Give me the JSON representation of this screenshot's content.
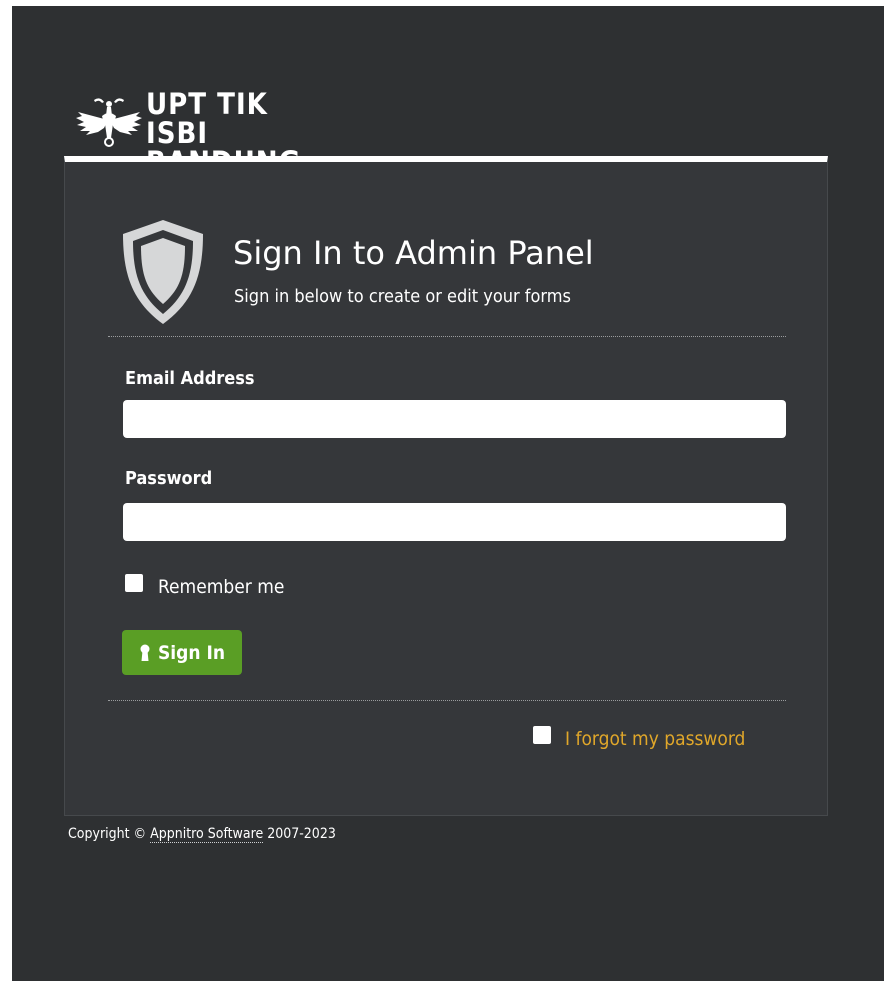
{
  "logo": {
    "line1": "UPT TIK",
    "line2": "ISBI BANDUNG",
    "icon": "isbi-emblem-icon"
  },
  "header": {
    "title": "Sign In to Admin Panel",
    "subtitle": "Sign in below to create or edit your forms",
    "icon": "shield-icon"
  },
  "form": {
    "email_label": "Email Address",
    "email_value": "",
    "password_label": "Password",
    "password_value": "",
    "remember_label": "Remember me",
    "signin_label": "Sign In",
    "signin_icon": "keyhole-icon",
    "forgot_label": "I forgot my password"
  },
  "footer": {
    "prefix": "Copyright © ",
    "link": "Appnitro Software",
    "suffix": " 2007-2023"
  },
  "colors": {
    "background": "#2e3032",
    "panel": "#35373a",
    "button": "#5a9e25",
    "link": "#e0a72a"
  }
}
